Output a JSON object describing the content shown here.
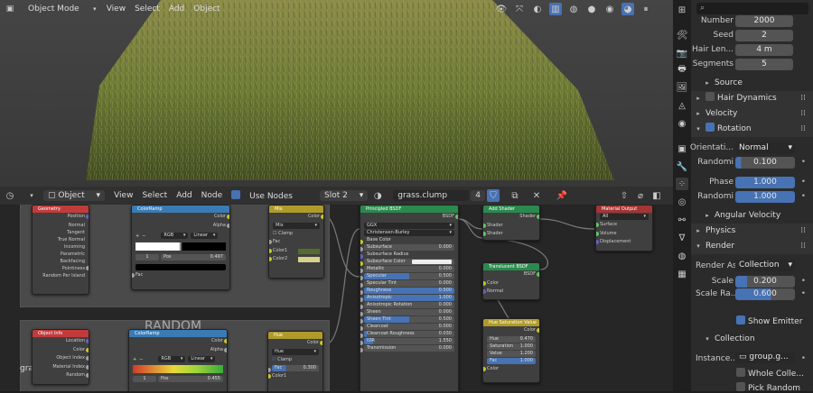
{
  "viewport": {
    "mode": "Object Mode",
    "menus": [
      "View",
      "Select",
      "Add",
      "Object"
    ]
  },
  "node_editor": {
    "type": "Object",
    "menus": [
      "View",
      "Select",
      "Add",
      "Node"
    ],
    "use_nodes": "Use Nodes",
    "slot": "Slot 2",
    "material": "grass.clump",
    "users": "4"
  },
  "frames": {
    "color": "COLOR",
    "random": "RANDOM",
    "label": "grass.clump"
  },
  "nodes": {
    "geometry": {
      "title": "Geometry",
      "outputs": [
        "Position",
        "Normal",
        "Tangent",
        "True Normal",
        "Incoming",
        "Parametric",
        "Backfacing",
        "Pointiness",
        "Random Per Island"
      ]
    },
    "colorramp1": {
      "title": "ColorRamp",
      "outputs": [
        "Color",
        "Alpha"
      ],
      "mode": "RGB",
      "interp": "Linear",
      "stop": "1",
      "pos_label": "Pos",
      "pos": "0.497",
      "input": "Fac"
    },
    "mix": {
      "title": "Mix",
      "output": "Color",
      "blend": "Mix",
      "clamp": "Clamp",
      "inputs": [
        "Fac",
        "Color1",
        "Color2"
      ]
    },
    "bsdf": {
      "title": "Principled BSDF",
      "output": "BSDF",
      "dist": "GGX",
      "sss": "Christensen-Burley",
      "rows": [
        {
          "k": "Base Color",
          "v": ""
        },
        {
          "k": "Subsurface",
          "v": "0.000"
        },
        {
          "k": "Subsurface Radius",
          "v": ""
        },
        {
          "k": "Subsurface Color",
          "v": ""
        },
        {
          "k": "Metallic",
          "v": "0.000"
        },
        {
          "k": "Specular",
          "v": "0.500"
        },
        {
          "k": "Specular Tint",
          "v": "0.000"
        },
        {
          "k": "Roughness",
          "v": "0.500"
        },
        {
          "k": "Anisotropic",
          "v": "1.000"
        },
        {
          "k": "Anisotropic Rotation",
          "v": "0.000"
        },
        {
          "k": "Sheen",
          "v": "0.000"
        },
        {
          "k": "Sheen Tint",
          "v": "0.500"
        },
        {
          "k": "Clearcoat",
          "v": "0.000"
        },
        {
          "k": "Clearcoat Roughness",
          "v": "0.030"
        },
        {
          "k": "IOR",
          "v": "1.550"
        },
        {
          "k": "Transmission",
          "v": "0.000"
        }
      ]
    },
    "addshader": {
      "title": "Add Shader",
      "output": "Shader",
      "inputs": [
        "Shader",
        "Shader"
      ]
    },
    "translucent": {
      "title": "Translucent BSDF",
      "output": "BSDF",
      "inputs": [
        "Color",
        "Normal"
      ]
    },
    "output": {
      "title": "Material Output",
      "target": "All",
      "inputs": [
        "Surface",
        "Volume",
        "Displacement"
      ]
    },
    "objectinfo": {
      "title": "Object Info",
      "outputs": [
        "Location",
        "Color",
        "Object Index",
        "Material Index",
        "Random"
      ]
    },
    "colorramp2": {
      "title": "ColorRamp",
      "outputs": [
        "Color",
        "Alpha"
      ],
      "mode": "RGB",
      "interp": "Linear",
      "stop": "1",
      "pos_label": "Pos",
      "pos": "0.455"
    },
    "hue": {
      "title": "Hue",
      "output": "Color",
      "blend": "Hue",
      "clamp": "Clamp",
      "fac_label": "Fac",
      "fac": "0.300",
      "input": "Color1"
    },
    "hsv": {
      "title": "Hue Saturation Value",
      "output": "Color",
      "rows": [
        {
          "k": "Hue",
          "v": "0.470"
        },
        {
          "k": "Saturation",
          "v": "1.000"
        },
        {
          "k": "Value",
          "v": "1.200"
        },
        {
          "k": "Fac",
          "v": "1.000"
        }
      ],
      "input": "Color"
    }
  },
  "props": {
    "fields": [
      {
        "label": "Number",
        "value": "2000"
      },
      {
        "label": "Seed",
        "value": "2"
      },
      {
        "label": "Hair Len...",
        "value": "4 m"
      },
      {
        "label": "Segments",
        "value": "5"
      }
    ],
    "source": "Source",
    "hair_dynamics": "Hair Dynamics",
    "velocity": "Velocity",
    "rotation": "Rotation",
    "orientation_label": "Orientati...",
    "orientation": "Normal",
    "randomi1_label": "Randomi",
    "randomi1": "0.100",
    "phase_label": "Phase",
    "phase": "1.000",
    "randomi2_label": "Randomi",
    "randomi2": "1.000",
    "angular_velocity": "Angular Velocity",
    "physics": "Physics",
    "render": "Render",
    "render_as_label": "Render As",
    "render_as": "Collection",
    "scale_label": "Scale",
    "scale": "0.200",
    "scale_rand_label": "Scale Ra...",
    "scale_rand": "0.600",
    "show_emitter": "Show Emitter",
    "collection": "Collection",
    "instance_label": "Instance...",
    "instance": "group.g...",
    "whole_collection": "Whole Colle...",
    "pick_random": "Pick Random"
  },
  "colors": {
    "accent": "#4772b3",
    "geometry": "#c23b3b",
    "converter": "#3a7bb5",
    "color": "#b09b2a",
    "shader": "#2a8a4d",
    "output": "#a53434"
  }
}
